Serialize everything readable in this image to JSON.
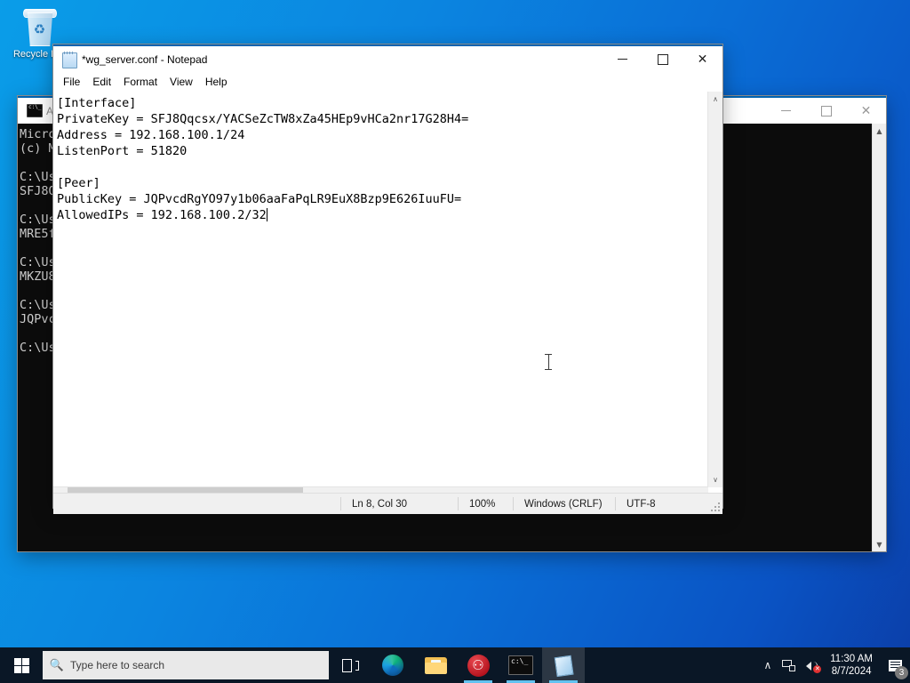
{
  "desktop": {
    "icons": [
      {
        "name": "recycle-bin",
        "label": "Recycle Bin"
      }
    ]
  },
  "cmd_window": {
    "title": "Administrator: Command Prompt",
    "icon": "command-prompt-icon",
    "minimize_label": "—",
    "maximize_label": "☐",
    "close_label": "✕",
    "console_text": "Microsoft Windows [Version 10.0.19045.4651]\n(c) Microsoft Corporation. All rights reserved.\n\nC:\\Users\\Admin>wg genkey\nSFJ8Qqcsx/YACSeZcTW8xZa45HEp9vHCa2nr17G28H4=\n\nC:\\Users\\Admin>wg genkey\nMRE5fXq2LpKd8WnTvB7yGhJ0sZcNaQ4UoE1iRdKxY3M=\n\nC:\\Users\\Admin>wg genkey\nMKZU8tDpA6sVqL3nYbJfRw9ExHc5QiO2TgdMv7ZkS0E=\n\nC:\\Users\\Admin>wg pubkey\nJQPvcdRgYO97y1b06aaFaPqLR9EuX8Bzp9E626IuuFU=\n\nC:\\Users\\Admin>"
  },
  "notepad": {
    "title": "*wg_server.conf - Notepad",
    "icon": "notepad-icon",
    "minimize_label": "—",
    "maximize_label": "☐",
    "close_label": "✕",
    "menu": [
      {
        "name": "menu-file",
        "label": "File"
      },
      {
        "name": "menu-edit",
        "label": "Edit"
      },
      {
        "name": "menu-format",
        "label": "Format"
      },
      {
        "name": "menu-view",
        "label": "View"
      },
      {
        "name": "menu-help",
        "label": "Help"
      }
    ],
    "document_text": "[Interface]\nPrivateKey = SFJ8Qqcsx/YACSeZcTW8xZa45HEp9vHCa2nr17G28H4=\nAddress = 192.168.100.1/24\nListenPort = 51820\n\n[Peer]\nPublicKey = JQPvcdRgYO97y1b06aaFaPqLR9EuX8Bzp9E626IuuFU=\nAllowedIPs = 192.168.100.2/32",
    "statusbar": {
      "cursor_position": "Ln 8, Col 30",
      "zoom": "100%",
      "line_ending": "Windows (CRLF)",
      "encoding": "UTF-8"
    },
    "scroll": {
      "up_arrow": "∧",
      "down_arrow": "∨",
      "left_arrow": "‹",
      "right_arrow": "›"
    }
  },
  "taskbar": {
    "start_label": "Start",
    "search": {
      "placeholder": "Type here to search",
      "value": "",
      "icon": "search-icon"
    },
    "buttons": [
      {
        "name": "task-view-button",
        "label": "Task View",
        "icon": "task-view-icon",
        "active": false,
        "running": false
      },
      {
        "name": "taskbar-edge",
        "label": "Microsoft Edge",
        "icon": "edge-icon",
        "active": false,
        "running": false
      },
      {
        "name": "taskbar-file-explorer",
        "label": "File Explorer",
        "icon": "folder-icon",
        "active": false,
        "running": false
      },
      {
        "name": "taskbar-wireguard",
        "label": "WireGuard",
        "icon": "wireguard-icon",
        "active": false,
        "running": true
      },
      {
        "name": "taskbar-command-prompt",
        "label": "Command Prompt",
        "icon": "command-prompt-icon",
        "active": false,
        "running": true
      },
      {
        "name": "taskbar-notepad",
        "label": "Notepad",
        "icon": "notepad-icon",
        "active": true,
        "running": true
      }
    ],
    "tray": {
      "overflow_label": "∧",
      "network_icon": "network-icon",
      "volume_icon": "speaker-muted-icon",
      "volume_mute_mark": "✕",
      "time": "11:30 AM",
      "date": "8/7/2024",
      "notifications_icon": "notifications-icon",
      "notification_count": "3"
    }
  },
  "colors": {
    "accent": "#0063b1",
    "taskbar": "#0a1726",
    "desktop_start": "#0a9de8",
    "desktop_end": "#0b3ea8",
    "console_bg": "#0c0c0c",
    "console_fg": "#cccccc",
    "active_underline": "#62c2f0",
    "mute_badge": "#e03131"
  }
}
